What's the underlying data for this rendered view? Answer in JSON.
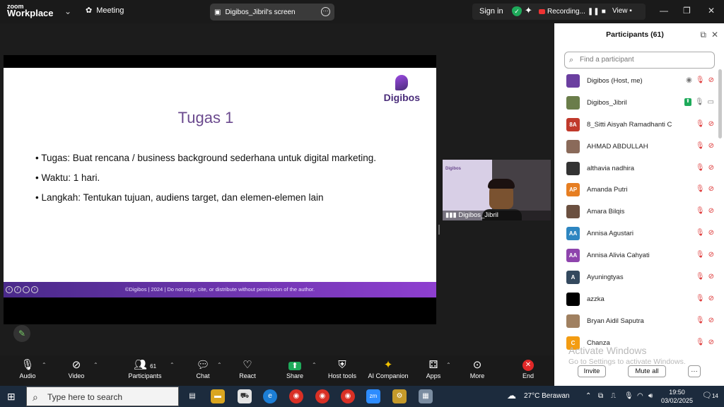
{
  "app": {
    "logo_line1": "zoom",
    "logo_line2": "Workplace",
    "meeting_label": "Meeting",
    "share_title": "Digibos_Jibril's screen",
    "signin": "Sign in",
    "recording": "Recording...",
    "view": "View"
  },
  "slide": {
    "brand": "Digibos",
    "title": "Tugas 1",
    "bullets": [
      "Tugas: Buat rencana / business background sederhana untuk digital marketing.",
      "Waktu: 1 hari.",
      "Langkah: Tentukan tujuan, audiens target, dan elemen-elemen lain"
    ],
    "footer": "©Digibos | 2024 | Do not copy, cite, or distribute without permission of the author."
  },
  "video": {
    "name": "Digibos_Jibril",
    "logo": "Digibos"
  },
  "toolbar": {
    "audio": "Audio",
    "video": "Video",
    "participants": "Participants",
    "participants_count": "61",
    "chat": "Chat",
    "react": "React",
    "share": "Share",
    "host_tools": "Host tools",
    "ai": "AI Companion",
    "apps": "Apps",
    "more": "More",
    "end": "End"
  },
  "panel": {
    "title": "Participants (61)",
    "search_placeholder": "Find a participant",
    "invite": "Invite",
    "mute_all": "Mute all",
    "more": "···",
    "participants": [
      {
        "name": "Digibos (Host, me)",
        "initials": "",
        "color": "#6b3fa0"
      },
      {
        "name": "Digibos_Jibril",
        "initials": "",
        "color": "#6a7d4a"
      },
      {
        "name": "8_Sitti Aisyah Ramadhanti C",
        "initials": "8A",
        "color": "#c0392b"
      },
      {
        "name": "AHMAD ABDULLAH",
        "initials": "",
        "color": "#8a6a5a"
      },
      {
        "name": "althavia nadhira",
        "initials": "",
        "color": "#333333"
      },
      {
        "name": "Amanda Putri",
        "initials": "AP",
        "color": "#e67e22"
      },
      {
        "name": "Amara Bilqis",
        "initials": "",
        "color": "#6b5040"
      },
      {
        "name": "Annisa Agustari",
        "initials": "AA",
        "color": "#2e86c1"
      },
      {
        "name": "Annisa Alivia Cahyati",
        "initials": "AA",
        "color": "#8e44ad"
      },
      {
        "name": "Ayuningtyas",
        "initials": "A",
        "color": "#34495e"
      },
      {
        "name": "azzka",
        "initials": "",
        "color": "#000000"
      },
      {
        "name": "Bryan Aidil Saputra",
        "initials": "",
        "color": "#a08060"
      },
      {
        "name": "Chanza",
        "initials": "C",
        "color": "#f39c12"
      }
    ]
  },
  "watermark": {
    "line1": "Activate Windows",
    "line2": "Go to Settings to activate Windows."
  },
  "taskbar": {
    "search": "Type here to search",
    "weather": "27°C  Berawan",
    "time": "19:50",
    "date": "03/02/2025",
    "notif": "14"
  }
}
